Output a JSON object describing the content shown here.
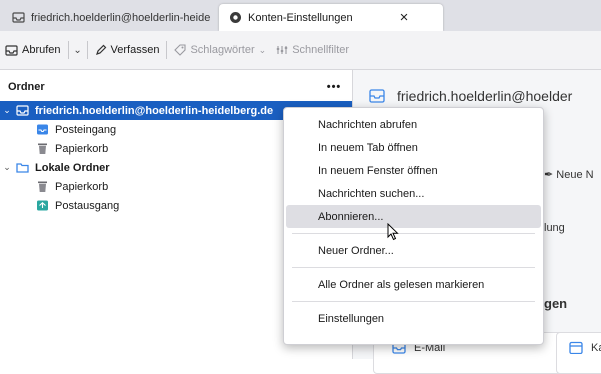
{
  "tabs": [
    {
      "label": "friedrich.hoelderlin@hoelderlin-heidelberg.de",
      "icon": "inbox-icon"
    },
    {
      "label": "Konten-Einstellungen",
      "icon": "settings-gear-icon",
      "close": "×"
    }
  ],
  "toolbar": {
    "get_messages": "Abrufen",
    "compose": "Verfassen",
    "tags": "Schlagwörter",
    "quick_filter": "Schnellfilter"
  },
  "folder_pane": {
    "title": "Ordner",
    "more": "•••",
    "account_label": "friedrich.hoelderlin@hoelderlin-heidelberg.de",
    "inbox": "Posteingang",
    "trash": "Papierkorb",
    "local_folders": "Lokale Ordner",
    "local_trash": "Papierkorb",
    "outbox": "Postausgang"
  },
  "right_pane": {
    "account_title": "friedrich.hoelderlin@hoelder",
    "new_frag": "Neue N",
    "frag_lung": "lung",
    "frag_gen": "gen",
    "email_card": "E-Mail",
    "frag_ka": "Ka"
  },
  "context_menu": {
    "get_messages": "Nachrichten abrufen",
    "open_new_tab": "In neuem Tab öffnen",
    "open_new_window": "In neuem Fenster öffnen",
    "search_messages": "Nachrichten suchen...",
    "subscribe": "Abonnieren...",
    "new_folder": "Neuer Ordner...",
    "mark_all_read": "Alle Ordner als gelesen markieren",
    "settings": "Einstellungen"
  },
  "colors": {
    "selection": "#1a5fc1",
    "hover": "#dedee3",
    "accent": "#3a86e8"
  }
}
